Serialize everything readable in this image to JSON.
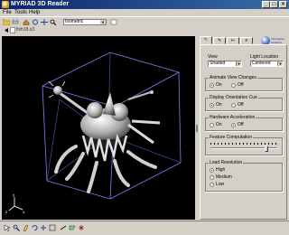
{
  "window": {
    "title": "MYRIAD 3D Reader",
    "buttons": [
      "_",
      "□",
      "×"
    ]
  },
  "menu": {
    "items": [
      "File",
      "Tools",
      "Help"
    ]
  },
  "toolbar": {
    "view_value": "Isometric",
    "icons": [
      "open-icon",
      "print-icon",
      "home-icon",
      "rotate-icon",
      "pan-icon",
      "zoom-icon",
      "fit-icon"
    ]
  },
  "file": {
    "name": "fish18.x3"
  },
  "panel": {
    "tabs": [
      "",
      "",
      "",
      ""
    ],
    "logo_text": "Informative Graphics",
    "view": {
      "label": "View",
      "value": "Shaded"
    },
    "light": {
      "label": "Light Location",
      "value": "Centered"
    },
    "animate": {
      "title": "Animate View Changes",
      "on": "On",
      "off": "Off",
      "selected": "on"
    },
    "orientation": {
      "title": "Display Orientation Cue",
      "on": "On",
      "off": "Off",
      "selected": "on"
    },
    "hardware": {
      "title": "Hardware Acceleration",
      "on": "On",
      "off": "Off",
      "selected": "off"
    },
    "feature": {
      "title": "Feature Computation",
      "level": 0.85
    },
    "load": {
      "title": "Load Resolution",
      "options": [
        "High",
        "Medium",
        "Low"
      ],
      "selected": 0
    }
  },
  "colors": {
    "title_start": "#0a246a",
    "title_end": "#3a6ea5",
    "viewport_bg": "#000000",
    "bounding_box": "#8080ff"
  }
}
